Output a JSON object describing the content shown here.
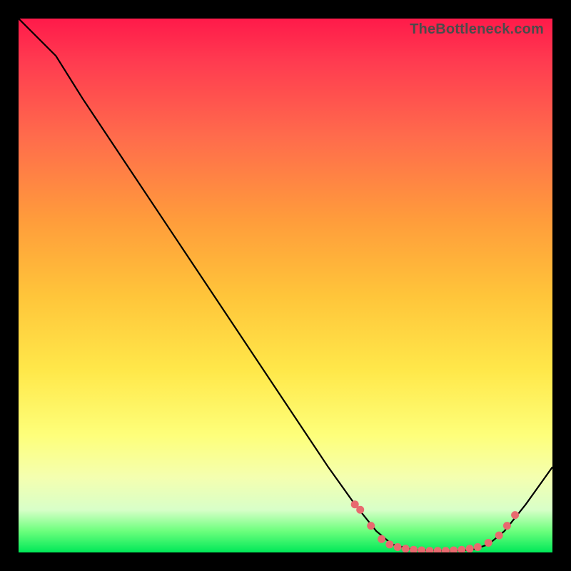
{
  "attribution": "TheBottleneck.com",
  "chart_data": {
    "type": "line",
    "title": "",
    "xlabel": "",
    "ylabel": "",
    "xlim": [
      0,
      100
    ],
    "ylim": [
      0,
      100
    ],
    "curve_points": [
      {
        "x": 0,
        "y": 100
      },
      {
        "x": 7,
        "y": 93
      },
      {
        "x": 12,
        "y": 85
      },
      {
        "x": 20,
        "y": 73
      },
      {
        "x": 30,
        "y": 58
      },
      {
        "x": 40,
        "y": 43
      },
      {
        "x": 50,
        "y": 28
      },
      {
        "x": 58,
        "y": 16
      },
      {
        "x": 63,
        "y": 9
      },
      {
        "x": 67,
        "y": 4
      },
      {
        "x": 70,
        "y": 1.5
      },
      {
        "x": 74,
        "y": 0.5
      },
      {
        "x": 80,
        "y": 0.3
      },
      {
        "x": 85,
        "y": 0.5
      },
      {
        "x": 88,
        "y": 1.5
      },
      {
        "x": 91,
        "y": 4
      },
      {
        "x": 95,
        "y": 9
      },
      {
        "x": 100,
        "y": 16
      }
    ],
    "sample_dots": [
      {
        "x": 63,
        "y": 9
      },
      {
        "x": 64,
        "y": 8
      },
      {
        "x": 66,
        "y": 5
      },
      {
        "x": 68,
        "y": 2.5
      },
      {
        "x": 69.5,
        "y": 1.5
      },
      {
        "x": 71,
        "y": 1.0
      },
      {
        "x": 72.5,
        "y": 0.7
      },
      {
        "x": 74,
        "y": 0.5
      },
      {
        "x": 75.5,
        "y": 0.4
      },
      {
        "x": 77,
        "y": 0.3
      },
      {
        "x": 78.5,
        "y": 0.3
      },
      {
        "x": 80,
        "y": 0.3
      },
      {
        "x": 81.5,
        "y": 0.4
      },
      {
        "x": 83,
        "y": 0.5
      },
      {
        "x": 84.5,
        "y": 0.7
      },
      {
        "x": 86,
        "y": 1.0
      },
      {
        "x": 88,
        "y": 1.8
      },
      {
        "x": 90,
        "y": 3.2
      },
      {
        "x": 91.5,
        "y": 5
      },
      {
        "x": 93,
        "y": 7
      }
    ],
    "dot_color": "#e86a6f",
    "notes": "Curve descends from top-left, flattens to near-zero around x≈70–85, then rises again. Dots cluster along the valley floor and lower walls."
  }
}
